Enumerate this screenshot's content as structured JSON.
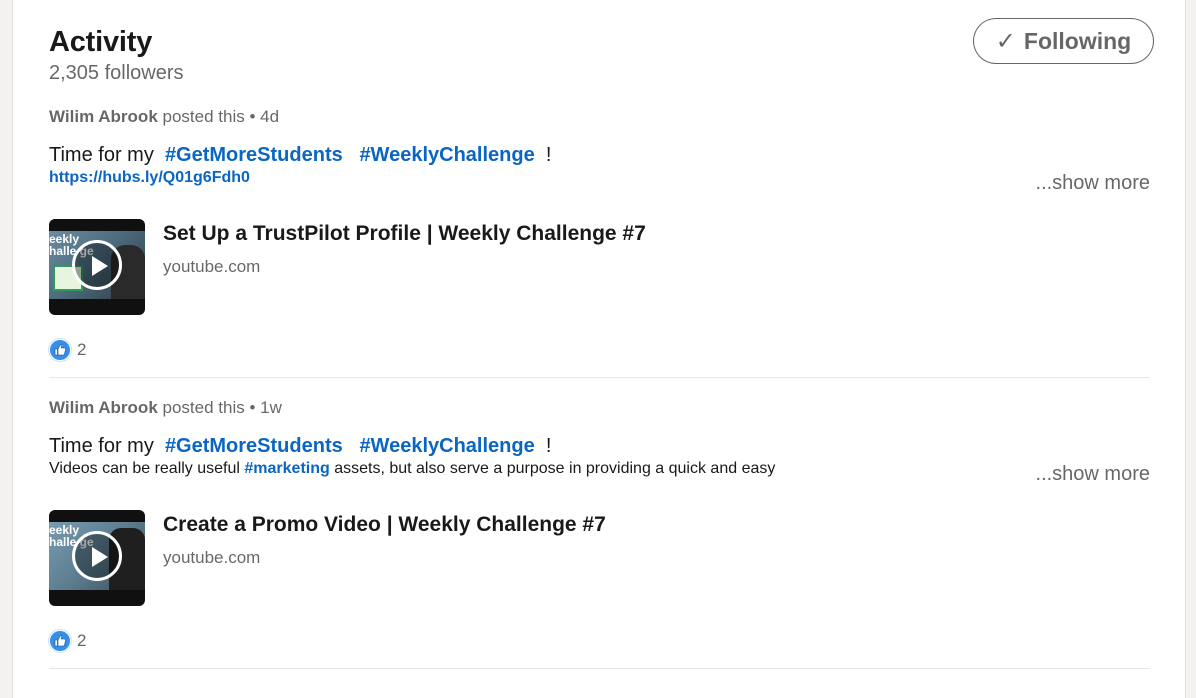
{
  "header": {
    "title": "Activity",
    "followers": "2,305 followers",
    "follow_button": "Following",
    "follow_check": "✓"
  },
  "posts": [
    {
      "author": "Wilim Abrook",
      "action": "posted this",
      "separator": "•",
      "time": "4d",
      "line1_prefix": "Time for my ",
      "hashtag1": "#GetMoreStudents",
      "hashtag2": "#WeeklyChallenge",
      "line1_suffix": " !",
      "line2_link": "https://hubs.ly/Q01g6Fdh0",
      "show_more": "...show more",
      "media_title": "Set Up a TrustPilot Profile | Weekly Challenge #7",
      "media_source": "youtube.com",
      "thumb_label": "eekly\nhalle ge",
      "reaction_count": "2"
    },
    {
      "author": "Wilim Abrook",
      "action": "posted this",
      "separator": "•",
      "time": "1w",
      "line1_prefix": "Time for my ",
      "hashtag1": "#GetMoreStudents",
      "hashtag2": "#WeeklyChallenge",
      "line1_suffix": " !",
      "line2_prefix": "Videos can be really useful ",
      "line2_hashtag": "#marketing",
      "line2_suffix": " assets, but also serve a purpose in providing a quick and easy",
      "show_more": "...show more",
      "media_title": "Create a Promo Video | Weekly Challenge #7",
      "media_source": "youtube.com",
      "thumb_label": "eekly\nhalle ge",
      "reaction_count": "2"
    }
  ],
  "colors": {
    "link": "#0a66c2",
    "reaction_like": "#378fe9"
  },
  "icons": {
    "reaction": "like-icon",
    "play": "play-icon",
    "check": "check-icon"
  }
}
